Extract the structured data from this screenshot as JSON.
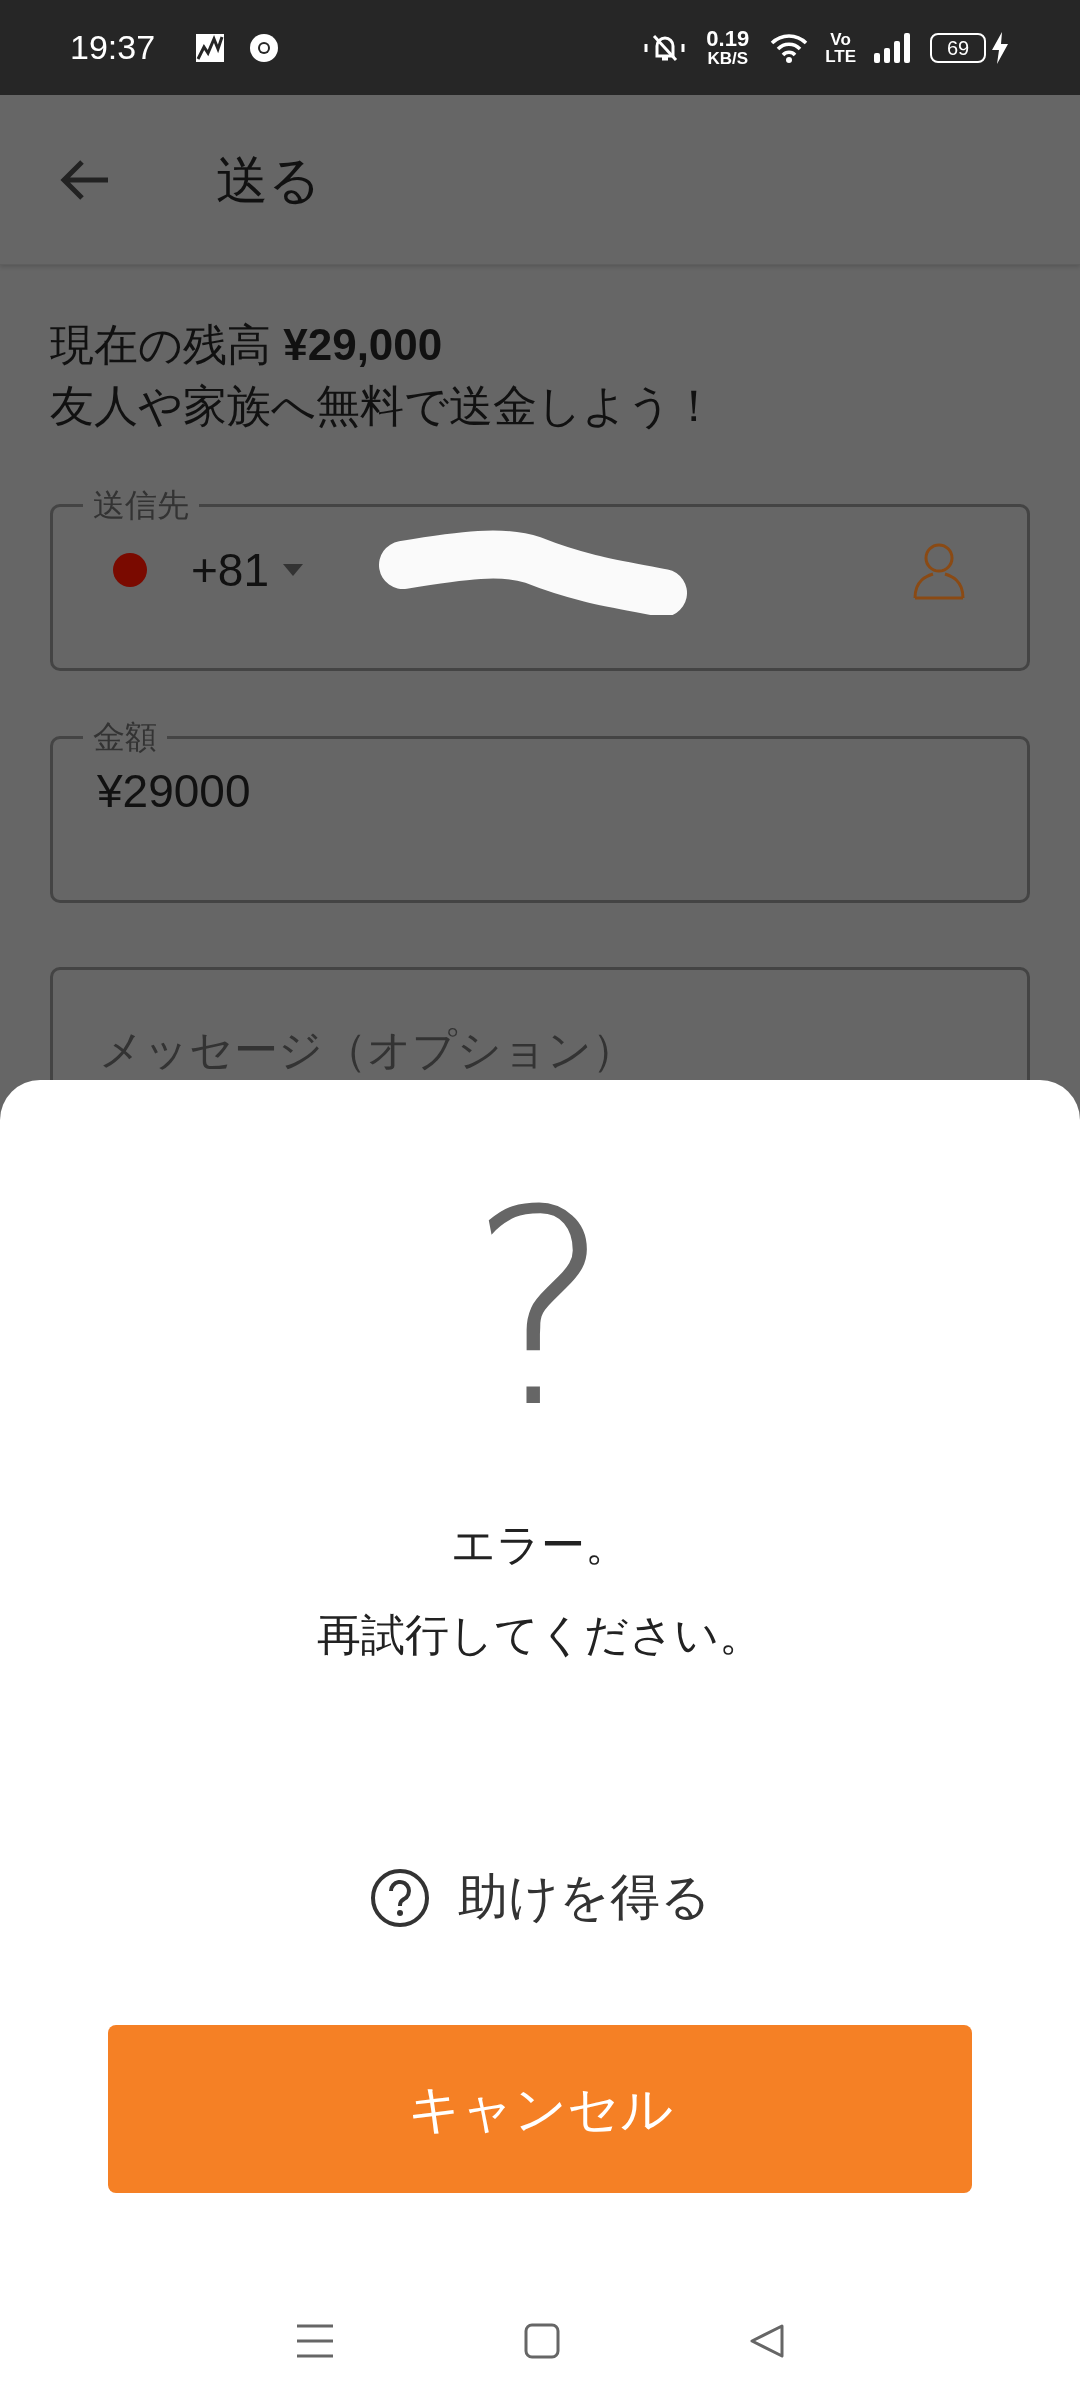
{
  "status_bar": {
    "time": "19:37",
    "net_speed": "0.19",
    "net_unit": "KB/S",
    "volte_top": "Vo",
    "volte_bottom": "LTE",
    "battery": "69"
  },
  "app_bar": {
    "title": "送る"
  },
  "balance": {
    "text": "現在の残高 **¥29,000**"
  },
  "subtitle": "友人や家族へ無料で送金しよう！",
  "recipient": {
    "label": "送信先",
    "country_code": "+81"
  },
  "amount": {
    "label": "金額",
    "value": "¥29000"
  },
  "message": {
    "placeholder": "メッセージ（オプション）"
  },
  "dialog": {
    "icon_glyph": "?",
    "lines": [
      "エラー。",
      "再試行してください。"
    ],
    "help_link": "助けを得る",
    "cancel_button": "キャンセル"
  }
}
